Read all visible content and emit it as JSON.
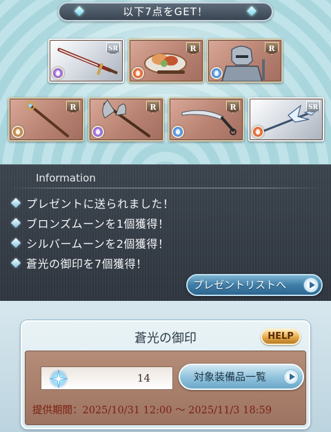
{
  "reward_banner": {
    "title": "以下7点をGET！",
    "items": [
      {
        "rarity": "SR",
        "element": "dark",
        "frame": "silver",
        "icon": "sword-icon"
      },
      {
        "rarity": "R",
        "element": "fire",
        "frame": "bronze",
        "icon": "food-plate-icon"
      },
      {
        "rarity": "R",
        "element": "water",
        "frame": "bronze",
        "icon": "armored-knight-icon"
      },
      {
        "rarity": "R",
        "element": "earth",
        "frame": "bronze",
        "icon": "staff-icon"
      },
      {
        "rarity": "R",
        "element": "dark",
        "frame": "bronze",
        "icon": "axe-icon"
      },
      {
        "rarity": "R",
        "element": "water",
        "frame": "bronze",
        "icon": "curved-blade-icon"
      },
      {
        "rarity": "SR",
        "element": "fire",
        "frame": "silver",
        "icon": "halberd-icon"
      }
    ]
  },
  "information": {
    "title": "Information",
    "messages": [
      "プレゼントに送られました！",
      "ブロンズムーンを1個獲得！",
      "シルバームーンを2個獲得！",
      "蒼光の御印を7個獲得！"
    ],
    "present_list_button": "プレゼントリストへ"
  },
  "seal_panel": {
    "title": "蒼光の御印",
    "help_label": "HELP",
    "count": "14",
    "equipment_list_button": "対象装備品一覧",
    "period": "提供期間：2025/10/31 12:00 〜 2025/11/3 18:59"
  },
  "colors": {
    "info_bg": "#333a43",
    "button_blue": "#3f7ea8",
    "period_text": "#7a1f12",
    "help_orange": "#e2a94a"
  }
}
